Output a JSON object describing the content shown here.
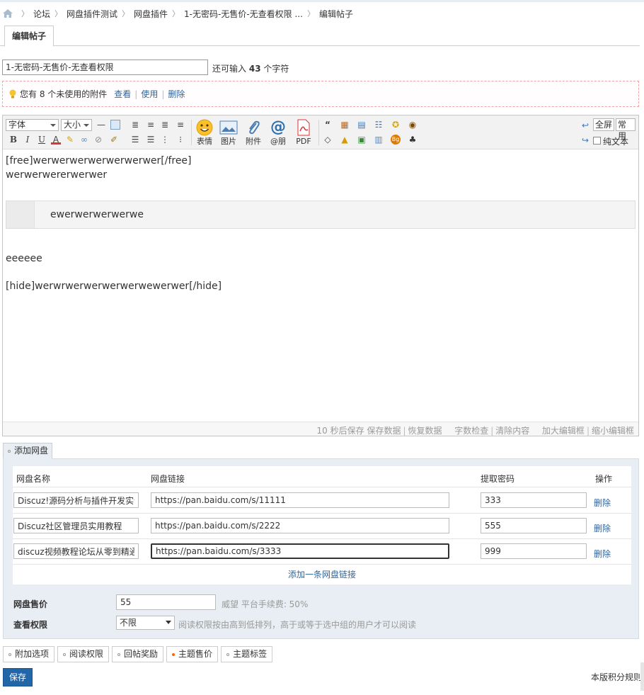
{
  "breadcrumb": {
    "items": [
      "论坛",
      "网盘插件测试",
      "网盘插件",
      "1-无密码-无售价-无查看权限 ...",
      "编辑帖子"
    ]
  },
  "tabs": {
    "active": "编辑帖子"
  },
  "subject": {
    "value": "1-无密码-无售价-无查看权限",
    "remain_prefix": "还可输入",
    "remain_count": "43",
    "remain_suffix": "个字符"
  },
  "attach_notice": {
    "text": "您有 8 个未使用的附件",
    "view": "查看",
    "use": "使用",
    "delete": "删除"
  },
  "toolbar": {
    "font_label": "字体",
    "size_label": "大小",
    "buttons": [
      {
        "label": "表情",
        "icon": "smiley-icon"
      },
      {
        "label": "图片",
        "icon": "image-icon"
      },
      {
        "label": "附件",
        "icon": "paperclip-icon"
      },
      {
        "label": "@朋",
        "icon": "at-icon"
      },
      {
        "label": "PDF",
        "icon": "pdf-icon"
      }
    ],
    "fullscreen": "全屏",
    "common": "常用",
    "plaintext": "纯文本"
  },
  "editor": {
    "lines": [
      "[free]werwerwerwerwerwerwer[/free]",
      "werwerwererwerwer",
      "eeeeee",
      "[hide]werwrwerwerwerwerwewerwer[/hide]"
    ],
    "quote": "ewerwerwerwerwe"
  },
  "status": {
    "autosave": "10 秒后保存",
    "save_data": "保存数据",
    "restore_data": "恢复数据",
    "word_check": "字数检查",
    "clear": "清除内容",
    "enlarge": "加大编辑框",
    "shrink": "缩小编辑框"
  },
  "disk": {
    "tab": "添加网盘",
    "headers": {
      "name": "网盘名称",
      "link": "网盘链接",
      "code": "提取密码",
      "ops": "操作"
    },
    "rows": [
      {
        "name": "Discuz!源码分析与插件开发实例讲",
        "link": "https://pan.baidu.com/s/11111",
        "code": "333",
        "del": "删除"
      },
      {
        "name": "Discuz社区管理员实用教程",
        "link": "https://pan.baidu.com/s/2222",
        "code": "555",
        "del": "删除"
      },
      {
        "name": "discuz视频教程论坛从零到精通dz",
        "link": "https://pan.baidu.com/s/3333",
        "code": "999",
        "del": "删除"
      }
    ],
    "add_link": "添加一条网盘链接",
    "price_label": "网盘售价",
    "price_value": "55",
    "price_note": "威望  平台手续费: 50%",
    "perm_label": "查看权限",
    "perm_value": "不限",
    "perm_note": "阅读权限按由高到低排列，高于或等于选中组的用户才可以阅读"
  },
  "options": [
    "附加选项",
    "阅读权限",
    "回帖奖励",
    "主题售价",
    "主题标签"
  ],
  "footer": {
    "save": "保存",
    "rules": "本版积分规则"
  }
}
